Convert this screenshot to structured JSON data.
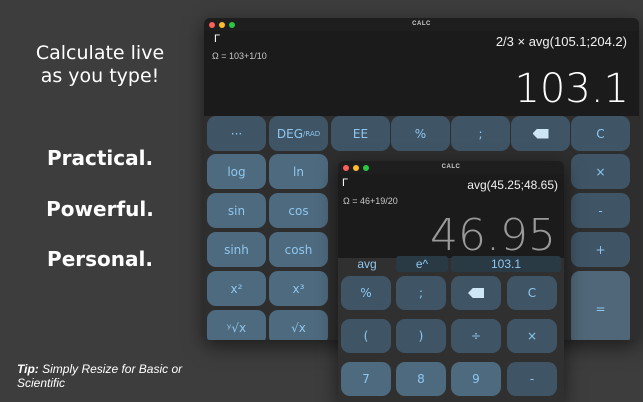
{
  "marketing": {
    "headline_line1": "Calculate live",
    "headline_line2": "as you type!",
    "tag1": "Practical.",
    "tag2": "Powerful.",
    "tag3": "Personal.",
    "tip_label": "Tip:",
    "tip_text": " Simply Resize for Basic or Scientific"
  },
  "large_window": {
    "title": "CALC",
    "gamma": "Γ",
    "expression": "2/3 × avg(105.1;204.2)",
    "previous": "Ω = 103+1/10",
    "result": "103.1",
    "keys": {
      "more": "···",
      "deg_rad": "DEG",
      "deg_rad_sub": "/RAD",
      "ee": "EE",
      "percent": "%",
      "semicolon": ";",
      "clear": "C",
      "log": "log",
      "ln": "ln",
      "multiply": "×",
      "sin": "sin",
      "cos": "cos",
      "minus": "-",
      "sinh": "sinh",
      "cosh": "cosh",
      "plus": "+",
      "x2": "x²",
      "x3": "x³",
      "yroot": "ʸ√x",
      "sqrt": "√x",
      "equals": "="
    }
  },
  "small_window": {
    "title": "CALC",
    "gamma": "Γ",
    "expression": "avg(45.25;48.65)",
    "previous": "Ω = 46+19/20",
    "result": "46.95",
    "memory": [
      "avg",
      "e^",
      "103.1"
    ],
    "keys": {
      "percent": "%",
      "semicolon": ";",
      "clear": "C",
      "open_paren": "(",
      "close_paren": ")",
      "divide": "÷",
      "multiply": "×",
      "seven": "7",
      "eight": "8",
      "nine": "9",
      "minus": "-"
    }
  }
}
